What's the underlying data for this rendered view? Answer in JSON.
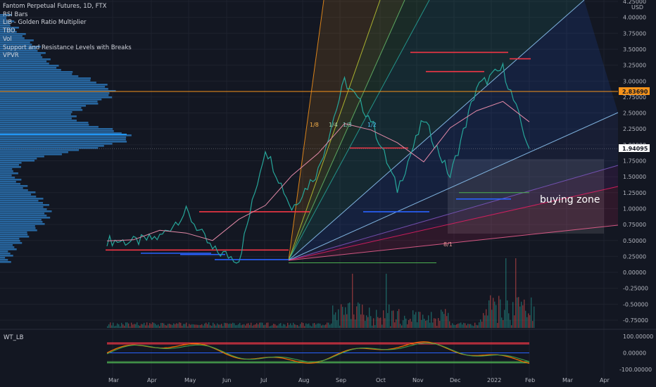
{
  "legend": {
    "title": "Fantom Perpetual Futures, 1D, FTX",
    "indicators": [
      "RSI Bars",
      "LIB - Golden Ratio Multiplier",
      "TBO",
      "Vol",
      "Support and Resistance Levels with Breaks",
      "VPVR"
    ]
  },
  "price_axis": {
    "unit": "USD",
    "ticks": [
      "4.25000",
      "4.00000",
      "3.75000",
      "3.50000",
      "3.25000",
      "3.00000",
      "2.75000",
      "2.50000",
      "2.25000",
      "2.00000",
      "1.75000",
      "1.50000",
      "1.25000",
      "1.00000",
      "0.75000",
      "0.50000",
      "0.25000",
      "0.00000",
      "-0.25000",
      "-0.50000",
      "-0.75000"
    ],
    "tick_values": [
      4.25,
      4.0,
      3.75,
      3.5,
      3.25,
      3.0,
      2.75,
      2.5,
      2.25,
      2.0,
      1.75,
      1.5,
      1.25,
      1.0,
      0.75,
      0.5,
      0.25,
      0.0,
      -0.25,
      -0.5,
      -0.75
    ]
  },
  "price_tags": {
    "orange": {
      "label": "2.83690",
      "value": 2.8369,
      "color": "#f7931a"
    },
    "last": {
      "label": "1.94095",
      "value": 1.94095,
      "color": "#ffffff"
    }
  },
  "time_axis": [
    "Mar",
    "Apr",
    "May",
    "Jun",
    "Jul",
    "Aug",
    "Sep",
    "Oct",
    "Nov",
    "Dec",
    "2022",
    "Feb",
    "Mar",
    "Apr"
  ],
  "fan_labels": [
    "1/8",
    "1/4",
    "1/3",
    "1/2",
    "8/1"
  ],
  "annotation": "buying zone",
  "osc": {
    "title": "WT_LB",
    "ticks": [
      "100.00000",
      "0.00000",
      "-100.00000"
    ],
    "tick_values": [
      100,
      0,
      -100
    ]
  },
  "colors": {
    "up": "#26a69a",
    "down": "#ef5350",
    "support": "#2962ff",
    "resistance": "#f23645",
    "orange": "#f7931a"
  },
  "chart_data": {
    "type": "line",
    "title": "Fantom Perpetual Futures, 1D, FTX",
    "ylim": [
      -0.75,
      4.25
    ],
    "x": [
      "Mar",
      "Apr",
      "May",
      "Jun",
      "Jul",
      "Aug",
      "Sep",
      "Sep",
      "Oct",
      "Oct",
      "Nov",
      "Nov",
      "Dec",
      "Dec",
      "2022",
      "Jan",
      "Feb"
    ],
    "series": [
      {
        "values": [
          0.5,
          0.48,
          0.55,
          0.95,
          0.35,
          0.2,
          1.95,
          1.0,
          1.6,
          3.0,
          2.4,
          1.3,
          2.4,
          1.5,
          2.9,
          3.2,
          1.94
        ]
      }
    ],
    "levels": {
      "resistance": [
        0.95,
        1.95,
        3.45,
        3.15,
        3.35
      ],
      "support": [
        0.3,
        0.2,
        0.95,
        1.15
      ],
      "horizontal": [
        2.8369
      ]
    }
  }
}
